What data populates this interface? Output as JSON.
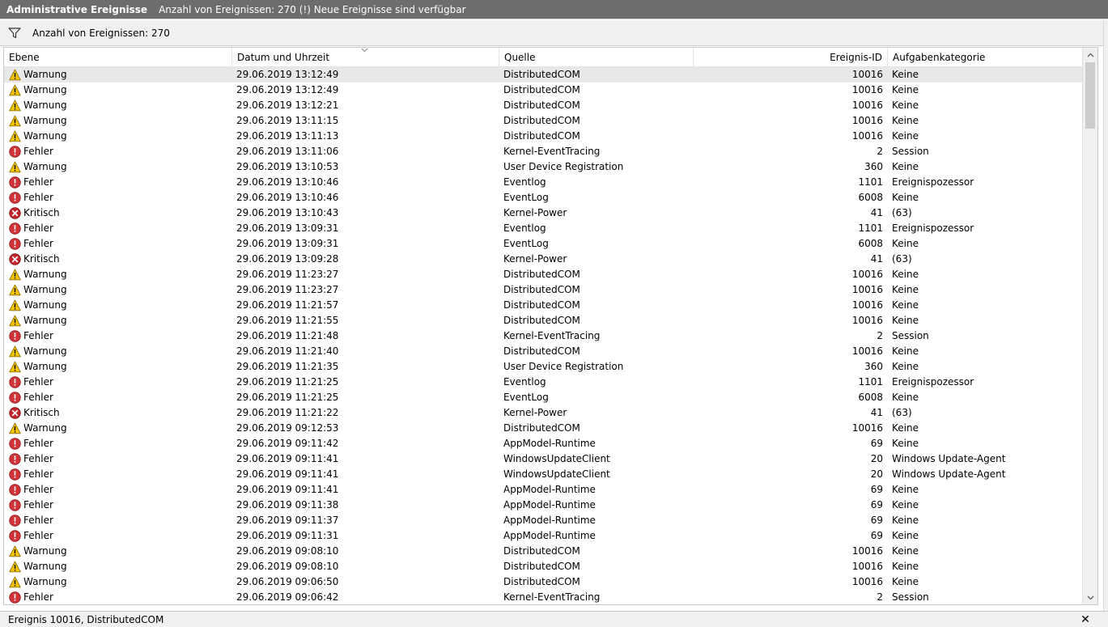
{
  "titlebar": {
    "title": "Administrative Ereignisse",
    "info": "Anzahl von Ereignissen: 270 (!) Neue Ereignisse sind verfügbar"
  },
  "filterbar": {
    "count_text": "Anzahl von Ereignissen: 270",
    "icon": "filter-funnel-icon"
  },
  "columns": {
    "level": "Ebene",
    "date": "Datum und Uhrzeit",
    "source": "Quelle",
    "id": "Ereignis-ID",
    "category": "Aufgabenkategorie"
  },
  "level_icons": {
    "Warnung": "warning-icon",
    "Fehler": "error-icon",
    "Kritisch": "critical-icon"
  },
  "colors": {
    "warning": "#f5c400",
    "error": "#d13438",
    "critical": "#c4262e",
    "titlebar": "#6d6d6d",
    "selected_row": "#e8e8e8"
  },
  "events": [
    {
      "level": "Warnung",
      "date": "29.06.2019 13:12:49",
      "source": "DistributedCOM",
      "id": "10016",
      "category": "Keine"
    },
    {
      "level": "Warnung",
      "date": "29.06.2019 13:12:49",
      "source": "DistributedCOM",
      "id": "10016",
      "category": "Keine"
    },
    {
      "level": "Warnung",
      "date": "29.06.2019 13:12:21",
      "source": "DistributedCOM",
      "id": "10016",
      "category": "Keine"
    },
    {
      "level": "Warnung",
      "date": "29.06.2019 13:11:15",
      "source": "DistributedCOM",
      "id": "10016",
      "category": "Keine"
    },
    {
      "level": "Warnung",
      "date": "29.06.2019 13:11:13",
      "source": "DistributedCOM",
      "id": "10016",
      "category": "Keine"
    },
    {
      "level": "Fehler",
      "date": "29.06.2019 13:11:06",
      "source": "Kernel-EventTracing",
      "id": "2",
      "category": "Session"
    },
    {
      "level": "Warnung",
      "date": "29.06.2019 13:10:53",
      "source": "User Device Registration",
      "id": "360",
      "category": "Keine"
    },
    {
      "level": "Fehler",
      "date": "29.06.2019 13:10:46",
      "source": "Eventlog",
      "id": "1101",
      "category": "Ereignispozessor"
    },
    {
      "level": "Fehler",
      "date": "29.06.2019 13:10:46",
      "source": "EventLog",
      "id": "6008",
      "category": "Keine"
    },
    {
      "level": "Kritisch",
      "date": "29.06.2019 13:10:43",
      "source": "Kernel-Power",
      "id": "41",
      "category": "(63)"
    },
    {
      "level": "Fehler",
      "date": "29.06.2019 13:09:31",
      "source": "Eventlog",
      "id": "1101",
      "category": "Ereignispozessor"
    },
    {
      "level": "Fehler",
      "date": "29.06.2019 13:09:31",
      "source": "EventLog",
      "id": "6008",
      "category": "Keine"
    },
    {
      "level": "Kritisch",
      "date": "29.06.2019 13:09:28",
      "source": "Kernel-Power",
      "id": "41",
      "category": "(63)"
    },
    {
      "level": "Warnung",
      "date": "29.06.2019 11:23:27",
      "source": "DistributedCOM",
      "id": "10016",
      "category": "Keine"
    },
    {
      "level": "Warnung",
      "date": "29.06.2019 11:23:27",
      "source": "DistributedCOM",
      "id": "10016",
      "category": "Keine"
    },
    {
      "level": "Warnung",
      "date": "29.06.2019 11:21:57",
      "source": "DistributedCOM",
      "id": "10016",
      "category": "Keine"
    },
    {
      "level": "Warnung",
      "date": "29.06.2019 11:21:55",
      "source": "DistributedCOM",
      "id": "10016",
      "category": "Keine"
    },
    {
      "level": "Fehler",
      "date": "29.06.2019 11:21:48",
      "source": "Kernel-EventTracing",
      "id": "2",
      "category": "Session"
    },
    {
      "level": "Warnung",
      "date": "29.06.2019 11:21:40",
      "source": "DistributedCOM",
      "id": "10016",
      "category": "Keine"
    },
    {
      "level": "Warnung",
      "date": "29.06.2019 11:21:35",
      "source": "User Device Registration",
      "id": "360",
      "category": "Keine"
    },
    {
      "level": "Fehler",
      "date": "29.06.2019 11:21:25",
      "source": "Eventlog",
      "id": "1101",
      "category": "Ereignispozessor"
    },
    {
      "level": "Fehler",
      "date": "29.06.2019 11:21:25",
      "source": "EventLog",
      "id": "6008",
      "category": "Keine"
    },
    {
      "level": "Kritisch",
      "date": "29.06.2019 11:21:22",
      "source": "Kernel-Power",
      "id": "41",
      "category": "(63)"
    },
    {
      "level": "Warnung",
      "date": "29.06.2019 09:12:53",
      "source": "DistributedCOM",
      "id": "10016",
      "category": "Keine"
    },
    {
      "level": "Fehler",
      "date": "29.06.2019 09:11:42",
      "source": "AppModel-Runtime",
      "id": "69",
      "category": "Keine"
    },
    {
      "level": "Fehler",
      "date": "29.06.2019 09:11:41",
      "source": "WindowsUpdateClient",
      "id": "20",
      "category": "Windows Update-Agent"
    },
    {
      "level": "Fehler",
      "date": "29.06.2019 09:11:41",
      "source": "WindowsUpdateClient",
      "id": "20",
      "category": "Windows Update-Agent"
    },
    {
      "level": "Fehler",
      "date": "29.06.2019 09:11:41",
      "source": "AppModel-Runtime",
      "id": "69",
      "category": "Keine"
    },
    {
      "level": "Fehler",
      "date": "29.06.2019 09:11:38",
      "source": "AppModel-Runtime",
      "id": "69",
      "category": "Keine"
    },
    {
      "level": "Fehler",
      "date": "29.06.2019 09:11:37",
      "source": "AppModel-Runtime",
      "id": "69",
      "category": "Keine"
    },
    {
      "level": "Fehler",
      "date": "29.06.2019 09:11:31",
      "source": "AppModel-Runtime",
      "id": "69",
      "category": "Keine"
    },
    {
      "level": "Warnung",
      "date": "29.06.2019 09:08:10",
      "source": "DistributedCOM",
      "id": "10016",
      "category": "Keine"
    },
    {
      "level": "Warnung",
      "date": "29.06.2019 09:08:10",
      "source": "DistributedCOM",
      "id": "10016",
      "category": "Keine"
    },
    {
      "level": "Warnung",
      "date": "29.06.2019 09:06:50",
      "source": "DistributedCOM",
      "id": "10016",
      "category": "Keine"
    },
    {
      "level": "Fehler",
      "date": "29.06.2019 09:06:42",
      "source": "Kernel-EventTracing",
      "id": "2",
      "category": "Session"
    }
  ],
  "statusbar": {
    "text": "Ereignis 10016, DistributedCOM",
    "close_label": "✕"
  }
}
